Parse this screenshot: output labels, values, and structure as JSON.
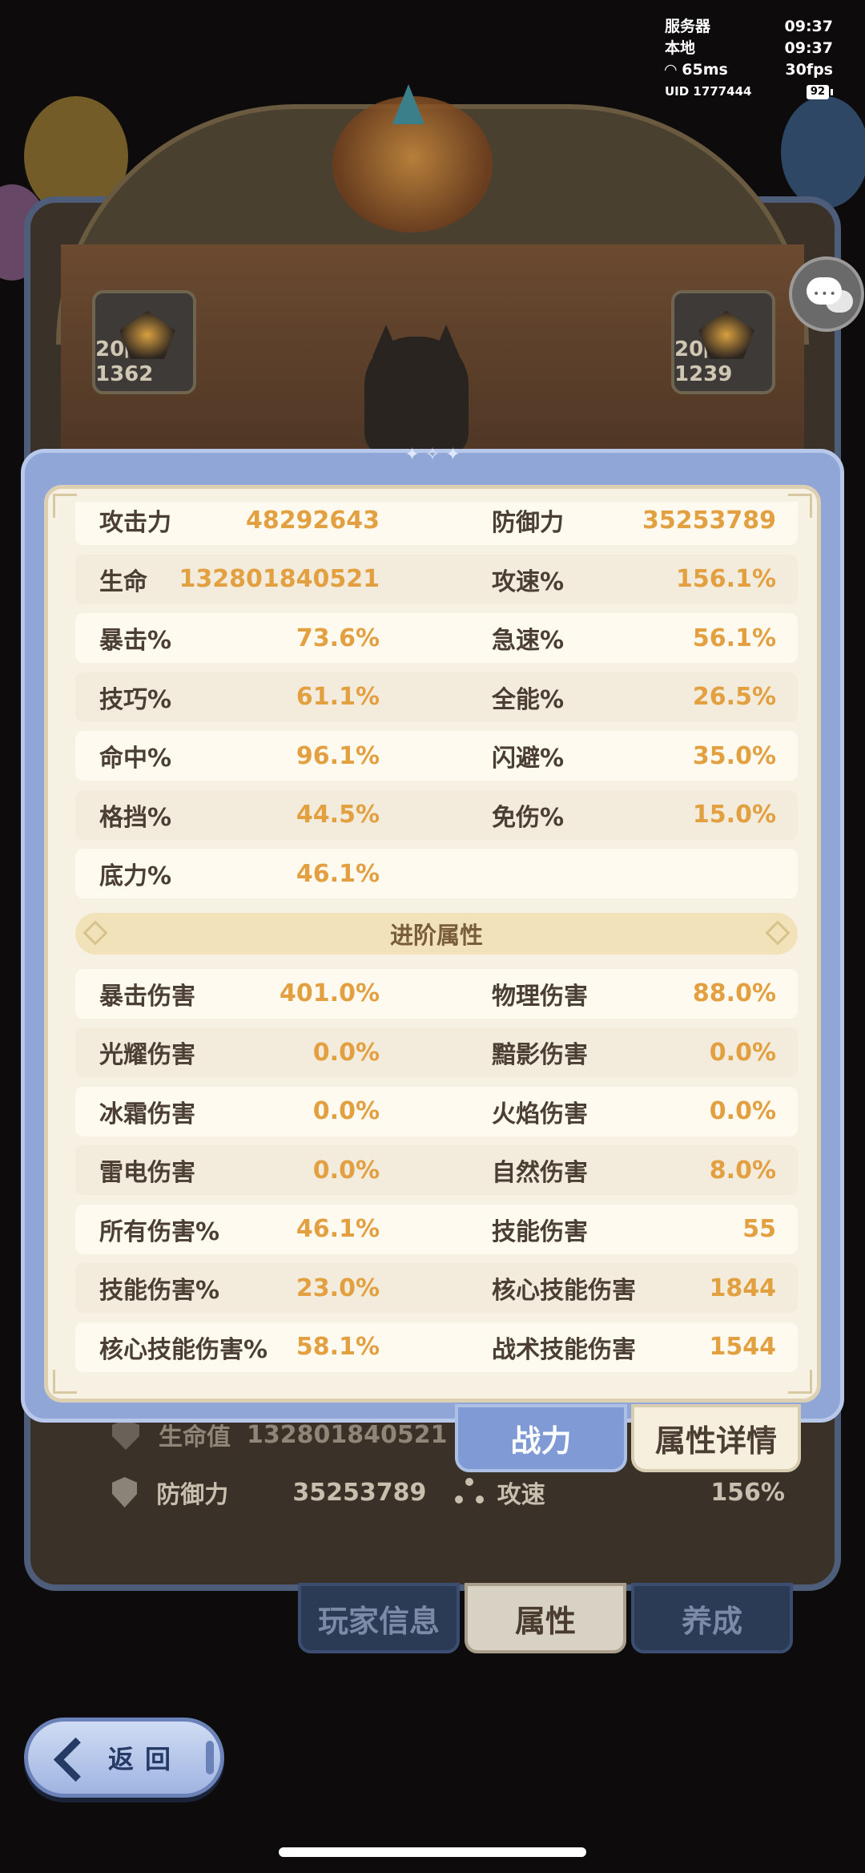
{
  "status": {
    "server_label": "服务器",
    "server_time": "09:37",
    "local_label": "本地",
    "local_time": "09:37",
    "ping": "65ms",
    "fps": "30fps",
    "uid": "UID 1777444",
    "battery": "92"
  },
  "equipment": {
    "left_label": "20阶1362",
    "right_label": "20阶1239"
  },
  "basic_stats": [
    {
      "l1": "攻击力",
      "v1": "48292643",
      "l2": "防御力",
      "v2": "35253789"
    },
    {
      "l1": "生命",
      "v1": "132801840521",
      "l2": "攻速%",
      "v2": "156.1%"
    },
    {
      "l1": "暴击%",
      "v1": "73.6%",
      "l2": "急速%",
      "v2": "56.1%"
    },
    {
      "l1": "技巧%",
      "v1": "61.1%",
      "l2": "全能%",
      "v2": "26.5%"
    },
    {
      "l1": "命中%",
      "v1": "96.1%",
      "l2": "闪避%",
      "v2": "35.0%"
    },
    {
      "l1": "格挡%",
      "v1": "44.5%",
      "l2": "免伤%",
      "v2": "15.0%"
    },
    {
      "l1": "底力%",
      "v1": "46.1%",
      "l2": "",
      "v2": ""
    }
  ],
  "advanced_section_title": "进阶属性",
  "advanced_stats": [
    {
      "l1": "暴击伤害",
      "v1": "401.0%",
      "l2": "物理伤害",
      "v2": "88.0%"
    },
    {
      "l1": "光耀伤害",
      "v1": "0.0%",
      "l2": "黯影伤害",
      "v2": "0.0%"
    },
    {
      "l1": "冰霜伤害",
      "v1": "0.0%",
      "l2": "火焰伤害",
      "v2": "0.0%"
    },
    {
      "l1": "雷电伤害",
      "v1": "0.0%",
      "l2": "自然伤害",
      "v2": "8.0%"
    },
    {
      "l1": "所有伤害%",
      "v1": "46.1%",
      "l2": "技能伤害",
      "v2": "55"
    },
    {
      "l1": "技能伤害%",
      "v1": "23.0%",
      "l2": "核心技能伤害",
      "v2": "1844"
    },
    {
      "l1": "核心技能伤害%",
      "v1": "58.1%",
      "l2": "战术技能伤害",
      "v2": "1544"
    }
  ],
  "panel_tabs": {
    "power": "战力",
    "details": "属性详情"
  },
  "summary": {
    "hp_label": "生命值",
    "hp_value": "132801840521",
    "def_label": "防御力",
    "def_value": "35253789",
    "spd_label": "攻速",
    "spd_value": "156%"
  },
  "bottom_tabs": {
    "player_info": "玩家信息",
    "attributes": "属性",
    "develop": "养成"
  },
  "back_label": "返回"
}
